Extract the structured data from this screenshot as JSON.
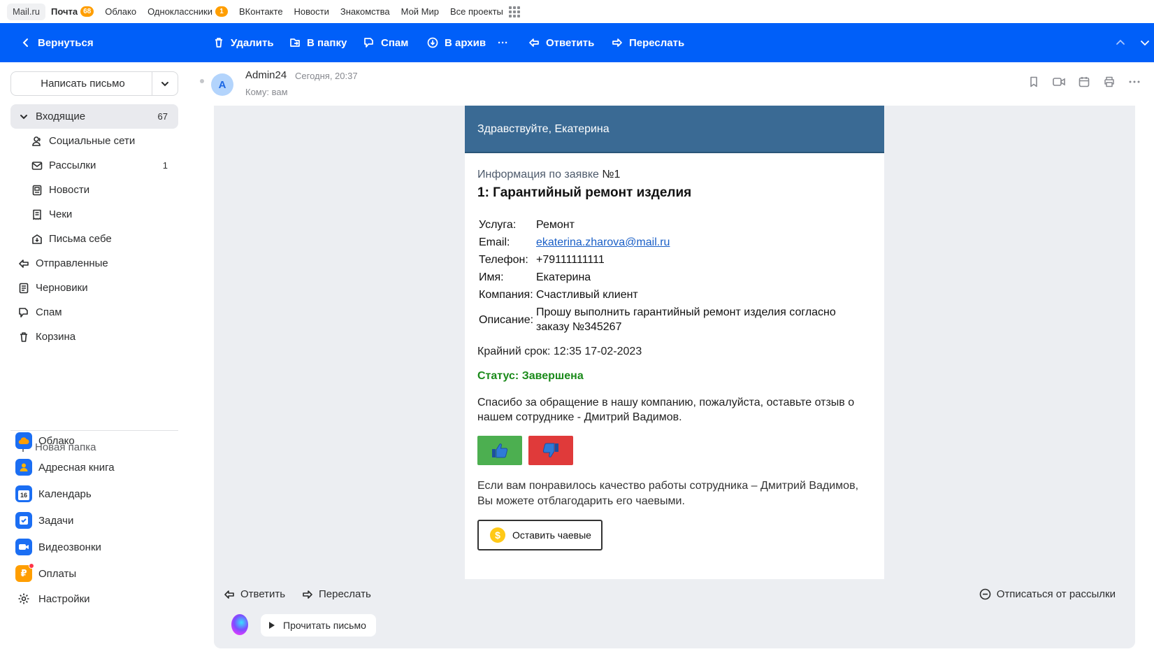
{
  "portal": {
    "items": [
      {
        "label": "Mail.ru"
      },
      {
        "label": "Почта",
        "badge": "68"
      },
      {
        "label": "Облако"
      },
      {
        "label": "Одноклассники",
        "badge": "1"
      },
      {
        "label": "ВКонтакте"
      },
      {
        "label": "Новости"
      },
      {
        "label": "Знакомства"
      },
      {
        "label": "Мой Мир"
      },
      {
        "label": "Все проекты"
      }
    ]
  },
  "toolbar": {
    "back": "Вернуться",
    "delete": "Удалить",
    "to_folder": "В папку",
    "spam": "Спам",
    "archive": "В архив",
    "more": "···",
    "reply": "Ответить",
    "forward": "Переслать"
  },
  "sidebar": {
    "compose": "Написать письмо",
    "folders": [
      {
        "label": "Входящие",
        "count": "67",
        "icon": "chevron-down-icon"
      },
      {
        "label": "Социальные сети",
        "icon": "people-icon"
      },
      {
        "label": "Рассылки",
        "count": "1",
        "icon": "newsletter-icon"
      },
      {
        "label": "Новости",
        "icon": "news-icon"
      },
      {
        "label": "Чеки",
        "icon": "receipt-icon"
      },
      {
        "label": "Письма себе",
        "icon": "self-mail-icon"
      },
      {
        "label": "Отправленные",
        "icon": "sent-icon"
      },
      {
        "label": "Черновики",
        "icon": "drafts-icon"
      },
      {
        "label": "Спам",
        "icon": "spam-icon"
      },
      {
        "label": "Корзина",
        "icon": "trash-icon"
      }
    ],
    "new_folder": "Новая папка",
    "apps": [
      {
        "label": "Облако",
        "icon": "cloud-icon",
        "color": "#1b6ef3"
      },
      {
        "label": "Адресная книга",
        "icon": "address-book-icon",
        "color": "#1b6ef3"
      },
      {
        "label": "Календарь",
        "icon": "calendar-icon",
        "color": "#1b6ef3",
        "day": "16"
      },
      {
        "label": "Задачи",
        "icon": "tasks-icon",
        "color": "#1b6ef3"
      },
      {
        "label": "Видеозвонки",
        "icon": "video-call-icon",
        "color": "#1b6ef3"
      },
      {
        "label": "Оплаты",
        "icon": "payments-icon",
        "color": "#ff9e00"
      },
      {
        "label": "Настройки",
        "icon": "gear-icon"
      }
    ]
  },
  "message": {
    "avatar_letter": "A",
    "sender": "Admin24",
    "date": "Сегодня, 20:37",
    "to": "Кому: вам"
  },
  "mail": {
    "greeting": "Здравствуйте, Екатерина",
    "request_info": "Информация по заявке",
    "request_number": "№1",
    "request_title": "1: Гарантийный ремонт изделия",
    "fields": [
      {
        "key": "Услуга:",
        "value": "Ремонт"
      },
      {
        "key": "Email:",
        "value": "ekaterina.zharova@mail.ru"
      },
      {
        "key": "Телефон:",
        "value": "+79111111111"
      },
      {
        "key": "Имя:",
        "value": "Екатерина"
      },
      {
        "key": "Компания:",
        "value": "Счастливый клиент"
      },
      {
        "key": "Описание:",
        "value": "Прошу выполнить гарантийный ремонт изделия согласно заказу №345267"
      }
    ],
    "deadline": "Крайний срок: 12:35 17-02-2023",
    "status": "Статус: Завершена",
    "thanks": "Спасибо за обращение в нашу компанию, пожалуйста, оставьте отзыв о нашем сотруднике - Дмитрий Вадимов.",
    "tip_text": "Если вам понравилось качество работы сотрудника – Дмитрий Вадимов, Вы можете отблагодарить его чаевыми.",
    "tip_button": "Оставить чаевые",
    "colors": {
      "header": "#3a6a94",
      "status": "#1a8a1a",
      "like": "#4caf50",
      "dislike": "#e03a3a"
    }
  },
  "bottom": {
    "reply": "Ответить",
    "forward": "Переслать",
    "unsubscribe": "Отписаться от рассылки",
    "read_aloud": "Прочитать письмо"
  },
  "accent": "#005ff9"
}
